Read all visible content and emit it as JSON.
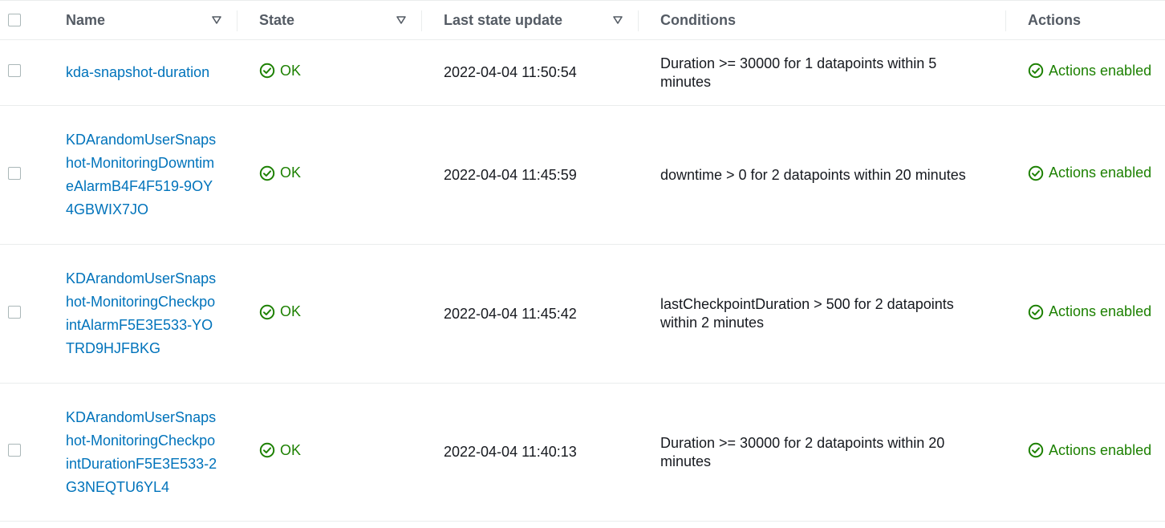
{
  "table": {
    "columns": {
      "name": "Name",
      "state": "State",
      "last_update": "Last state update",
      "conditions": "Conditions",
      "actions": "Actions"
    },
    "rows": [
      {
        "name": "kda-snapshot-duration",
        "state": "OK",
        "last_update": "2022-04-04 11:50:54",
        "conditions": "Duration >= 30000 for 1 datapoints within 5 minutes",
        "actions": "Actions enabled"
      },
      {
        "name": "KDArandomUserSnapshot-MonitoringDowntimeAlarmB4F4F519-9OY4GBWIX7JO",
        "state": "OK",
        "last_update": "2022-04-04 11:45:59",
        "conditions": "downtime > 0 for 2 datapoints within 20 minutes",
        "actions": "Actions enabled"
      },
      {
        "name": "KDArandomUserSnapshot-MonitoringCheckpointAlarmF5E3E533-YOTRD9HJFBKG",
        "state": "OK",
        "last_update": "2022-04-04 11:45:42",
        "conditions": "lastCheckpointDuration > 500 for 2 datapoints within 2 minutes",
        "actions": "Actions enabled"
      },
      {
        "name": "KDArandomUserSnapshot-MonitoringCheckpointDurationF5E3E533-2G3NEQTU6YL4",
        "state": "OK",
        "last_update": "2022-04-04 11:40:13",
        "conditions": "Duration >= 30000 for 2 datapoints within 20 minutes",
        "actions": "Actions enabled"
      }
    ]
  },
  "colors": {
    "link": "#0073bb",
    "success": "#1d8102",
    "header_text": "#545b64",
    "border": "#eaeded"
  }
}
